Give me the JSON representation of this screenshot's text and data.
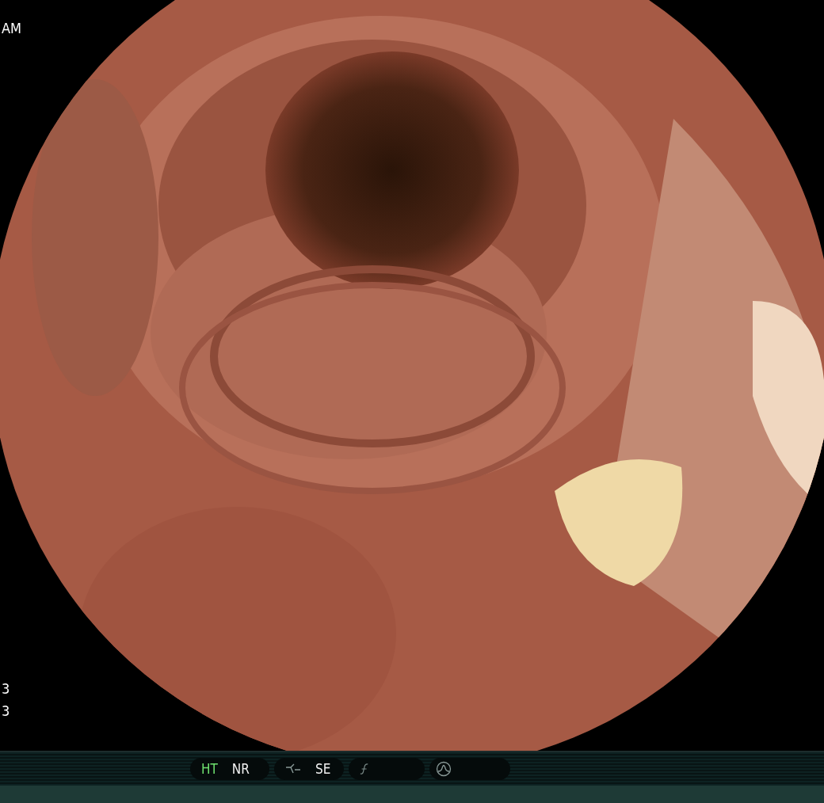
{
  "top_left_texts": [
    "AM"
  ],
  "bottom_left_texts": [
    "3",
    "3"
  ],
  "status_bar": {
    "groups": [
      {
        "kind": "labels",
        "items": [
          {
            "label": "HT",
            "on": true
          },
          {
            "label": "NR",
            "on": false
          }
        ]
      },
      {
        "kind": "tone",
        "items": [
          {
            "label": "SE",
            "on": false
          }
        ]
      },
      {
        "kind": "function"
      },
      {
        "kind": "wave"
      }
    ]
  }
}
